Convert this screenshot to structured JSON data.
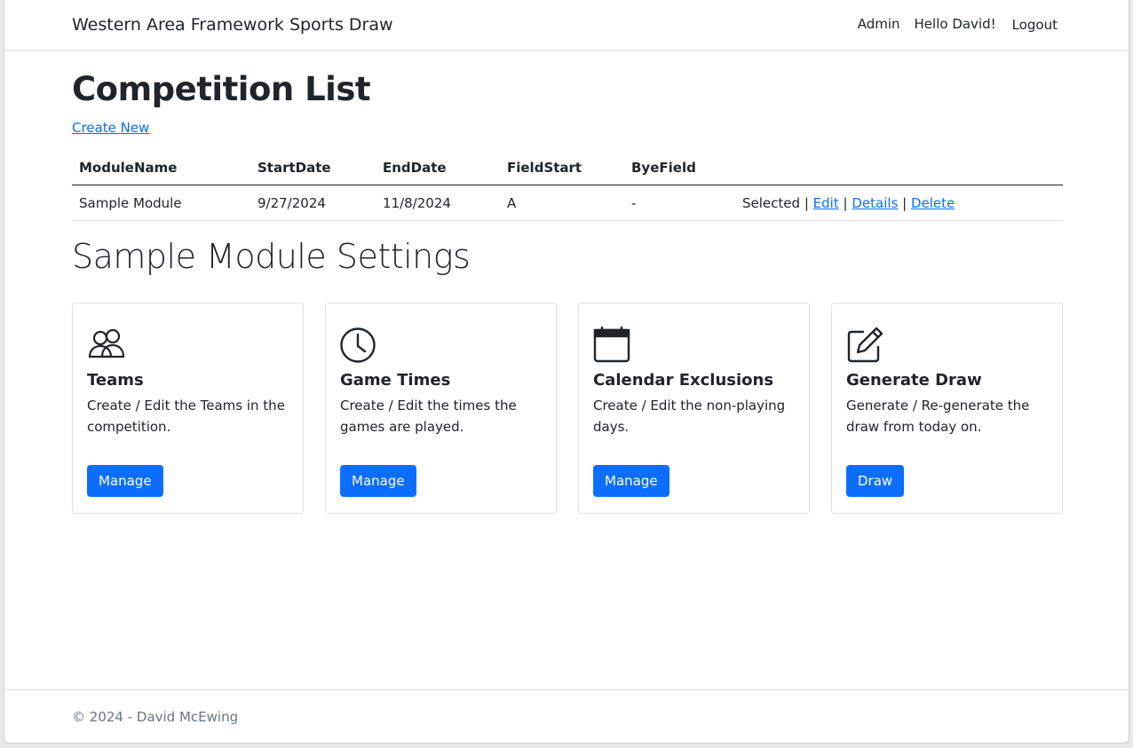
{
  "navbar": {
    "brand": "Western Area Framework Sports Draw",
    "admin": "Admin",
    "hello": "Hello David!",
    "logout": "Logout"
  },
  "page": {
    "title": "Competition List",
    "create_new": "Create New"
  },
  "table": {
    "headers": [
      "ModuleName",
      "StartDate",
      "EndDate",
      "FieldStart",
      "ByeField",
      ""
    ],
    "rows": [
      {
        "module_name": "Sample Module",
        "start_date": "9/27/2024",
        "end_date": "11/8/2024",
        "field_start": "A",
        "bye_field": "-",
        "selected": "Selected",
        "sep": "|",
        "edit": "Edit",
        "details": "Details",
        "delete": "Delete"
      }
    ]
  },
  "settings": {
    "title": "Sample Module Settings",
    "cards": [
      {
        "icon": "people-icon",
        "title": "Teams",
        "text": "Create / Edit the Teams in the competition.",
        "button": "Manage"
      },
      {
        "icon": "clock-icon",
        "title": "Game Times",
        "text": "Create / Edit the times the games are played.",
        "button": "Manage"
      },
      {
        "icon": "calendar-icon",
        "title": "Calendar Exclusions",
        "text": "Create / Edit the non-playing days.",
        "button": "Manage"
      },
      {
        "icon": "pencil-square-icon",
        "title": "Generate Draw",
        "text": "Generate / Re-generate the draw from today on.",
        "button": "Draw"
      }
    ]
  },
  "footer": {
    "text": "© 2024 - David McEwing"
  },
  "colors": {
    "primary": "#0d6efd",
    "text": "#212529",
    "muted": "#6c757d"
  }
}
